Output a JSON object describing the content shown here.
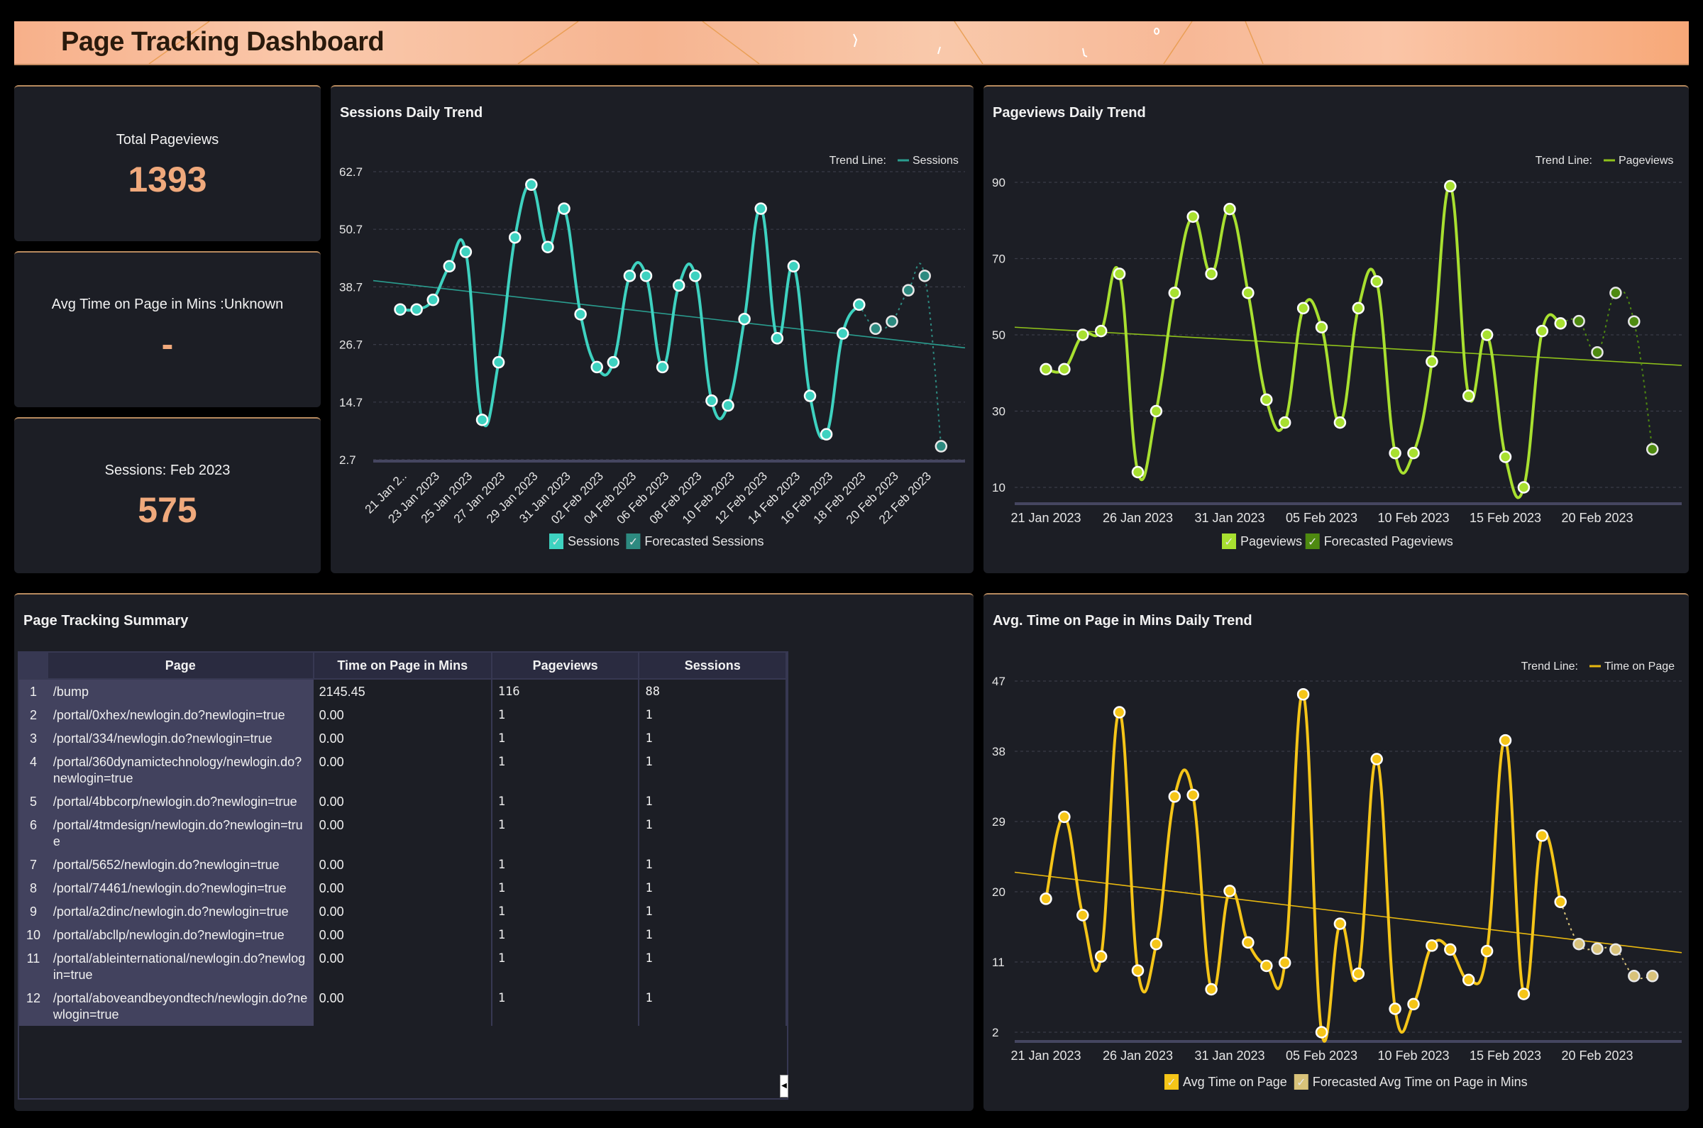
{
  "header": {
    "title": "Page Tracking Dashboard"
  },
  "kpis": [
    {
      "label": "Total Pageviews",
      "value": "1393"
    },
    {
      "label": "Avg Time on Page in Mins :Unknown",
      "value": "-"
    },
    {
      "label": "Sessions: Feb 2023",
      "value": "575"
    }
  ],
  "table": {
    "title": "Page Tracking Summary",
    "columns": [
      "Page",
      "Time on Page in Mins",
      "Pageviews",
      "Sessions"
    ],
    "rows": [
      {
        "n": "1",
        "page": "/bump",
        "time": "2145.45",
        "pageviews": "116",
        "sessions": "88"
      },
      {
        "n": "2",
        "page": "/portal/0xhex/newlogin.do?newlogin=true",
        "time": "0.00",
        "pageviews": "1",
        "sessions": "1"
      },
      {
        "n": "3",
        "page": "/portal/334/newlogin.do?newlogin=true",
        "time": "0.00",
        "pageviews": "1",
        "sessions": "1"
      },
      {
        "n": "4",
        "page": "/portal/360dynamictechnology/newlogin.do?newlogin=true",
        "time": "0.00",
        "pageviews": "1",
        "sessions": "1"
      },
      {
        "n": "5",
        "page": "/portal/4bbcorp/newlogin.do?newlogin=true",
        "time": "0.00",
        "pageviews": "1",
        "sessions": "1"
      },
      {
        "n": "6",
        "page": "/portal/4tmdesign/newlogin.do?newlogin=true",
        "time": "0.00",
        "pageviews": "1",
        "sessions": "1"
      },
      {
        "n": "7",
        "page": "/portal/5652/newlogin.do?newlogin=true",
        "time": "0.00",
        "pageviews": "1",
        "sessions": "1"
      },
      {
        "n": "8",
        "page": "/portal/74461/newlogin.do?newlogin=true",
        "time": "0.00",
        "pageviews": "1",
        "sessions": "1"
      },
      {
        "n": "9",
        "page": "/portal/a2dinc/newlogin.do?newlogin=true",
        "time": "0.00",
        "pageviews": "1",
        "sessions": "1"
      },
      {
        "n": "10",
        "page": "/portal/abcllp/newlogin.do?newlogin=true",
        "time": "0.00",
        "pageviews": "1",
        "sessions": "1"
      },
      {
        "n": "11",
        "page": "/portal/ableinternational/newlogin.do?newlogin=true",
        "time": "0.00",
        "pageviews": "1",
        "sessions": "1"
      },
      {
        "n": "12",
        "page": "/portal/aboveandbeyondtech/newlogin.do?newlogin=true",
        "time": "0.00",
        "pageviews": "1",
        "sessions": "1"
      }
    ]
  },
  "chart_data": [
    {
      "id": "sessions",
      "type": "line",
      "title": "Sessions Daily Trend",
      "xlabel": "",
      "ylabel": "",
      "x_start": "2023-01-21",
      "x_tick_labels": [
        "21 Jan 2..",
        "23 Jan 2023",
        "25 Jan 2023",
        "27 Jan 2023",
        "29 Jan 2023",
        "31 Jan 2023",
        "02 Feb 2023",
        "04 Feb 2023",
        "06 Feb 2023",
        "08 Feb 2023",
        "10 Feb 2023",
        "12 Feb 2023",
        "14 Feb 2023",
        "16 Feb 2023",
        "18 Feb 2023",
        "20 Feb 2023",
        "22 Feb 2023"
      ],
      "y_ticks": [
        2.7,
        14.7,
        26.7,
        38.7,
        50.7,
        62.7
      ],
      "ylim": [
        2.7,
        62.7
      ],
      "grid": true,
      "trend_legend": {
        "label": "Trend Line:",
        "series": "Sessions"
      },
      "trend_line": {
        "start": 40,
        "end": 26
      },
      "series": [
        {
          "name": "Sessions",
          "color": "#3ed2c0",
          "values": [
            34,
            34,
            36,
            43,
            46,
            11,
            23,
            49,
            60,
            47,
            55,
            33,
            22,
            23,
            41,
            41,
            22,
            39,
            41,
            15,
            14,
            32,
            55,
            28,
            43,
            16,
            8,
            29,
            35
          ]
        },
        {
          "name": "Forecasted Sessions",
          "color": "#2d8a80",
          "values": [
            30,
            31.5,
            38,
            41,
            5.5
          ]
        }
      ],
      "legend": [
        "Sessions",
        "Forecasted Sessions"
      ]
    },
    {
      "id": "pageviews",
      "type": "line",
      "title": "Pageviews Daily Trend",
      "xlabel": "",
      "ylabel": "",
      "x_start": "2023-01-21",
      "x_tick_labels": [
        "21 Jan 2023",
        "26 Jan 2023",
        "31 Jan 2023",
        "05 Feb 2023",
        "10 Feb 2023",
        "15 Feb 2023",
        "20 Feb 2023"
      ],
      "y_ticks": [
        10,
        30,
        50,
        70,
        90
      ],
      "ylim": [
        10,
        90
      ],
      "grid": true,
      "trend_legend": {
        "label": "Trend Line:",
        "series": "Pageviews"
      },
      "trend_line": {
        "start": 52,
        "end": 42
      },
      "series": [
        {
          "name": "Pageviews",
          "color": "#a8e030",
          "values": [
            41,
            41,
            50,
            51,
            66,
            14,
            30,
            61,
            81,
            66,
            83,
            61,
            33,
            27,
            57,
            52,
            27,
            57,
            64,
            19,
            19,
            43,
            89,
            34,
            50,
            18,
            10,
            51,
            53
          ]
        },
        {
          "name": "Forecasted Pageviews",
          "color": "#4e8a10",
          "values": [
            53.6,
            45.4,
            61,
            53.5,
            20
          ]
        }
      ],
      "legend": [
        "Pageviews",
        "Forecasted Pageviews"
      ]
    },
    {
      "id": "avgtime",
      "type": "line",
      "title": "Avg. Time on Page in Mins Daily Trend",
      "xlabel": "",
      "ylabel": "",
      "x_start": "2023-01-21",
      "x_tick_labels": [
        "21 Jan 2023",
        "26 Jan 2023",
        "31 Jan 2023",
        "05 Feb 2023",
        "10 Feb 2023",
        "15 Feb 2023",
        "20 Feb 2023"
      ],
      "y_ticks": [
        2,
        11,
        20,
        29,
        38,
        47
      ],
      "ylim": [
        2,
        47
      ],
      "grid": true,
      "trend_legend": {
        "label": "Trend Line:",
        "series": "Time on Page"
      },
      "trend_line": {
        "start": 22.5,
        "end": 12.2
      },
      "series": [
        {
          "name": "Avg Time on Page",
          "color": "#f5c518",
          "values": [
            19.1,
            29.6,
            17,
            11.7,
            43,
            9.9,
            13.3,
            32.2,
            32.4,
            7.5,
            20.1,
            13.5,
            10.5,
            10.9,
            45.3,
            2,
            15.9,
            9.5,
            37,
            5,
            5.6,
            13.1,
            12.6,
            8.7,
            12.4,
            39.4,
            6.9,
            27.2,
            18.7
          ]
        },
        {
          "name": "Forecasted Avg Time on Page in Mins",
          "color": "#d8c27a",
          "values": [
            13.3,
            12.7,
            12.6,
            9.2,
            9.2
          ]
        }
      ],
      "legend": [
        "Avg Time on Page",
        "Forecasted Avg Time on Page in Mins"
      ]
    }
  ]
}
